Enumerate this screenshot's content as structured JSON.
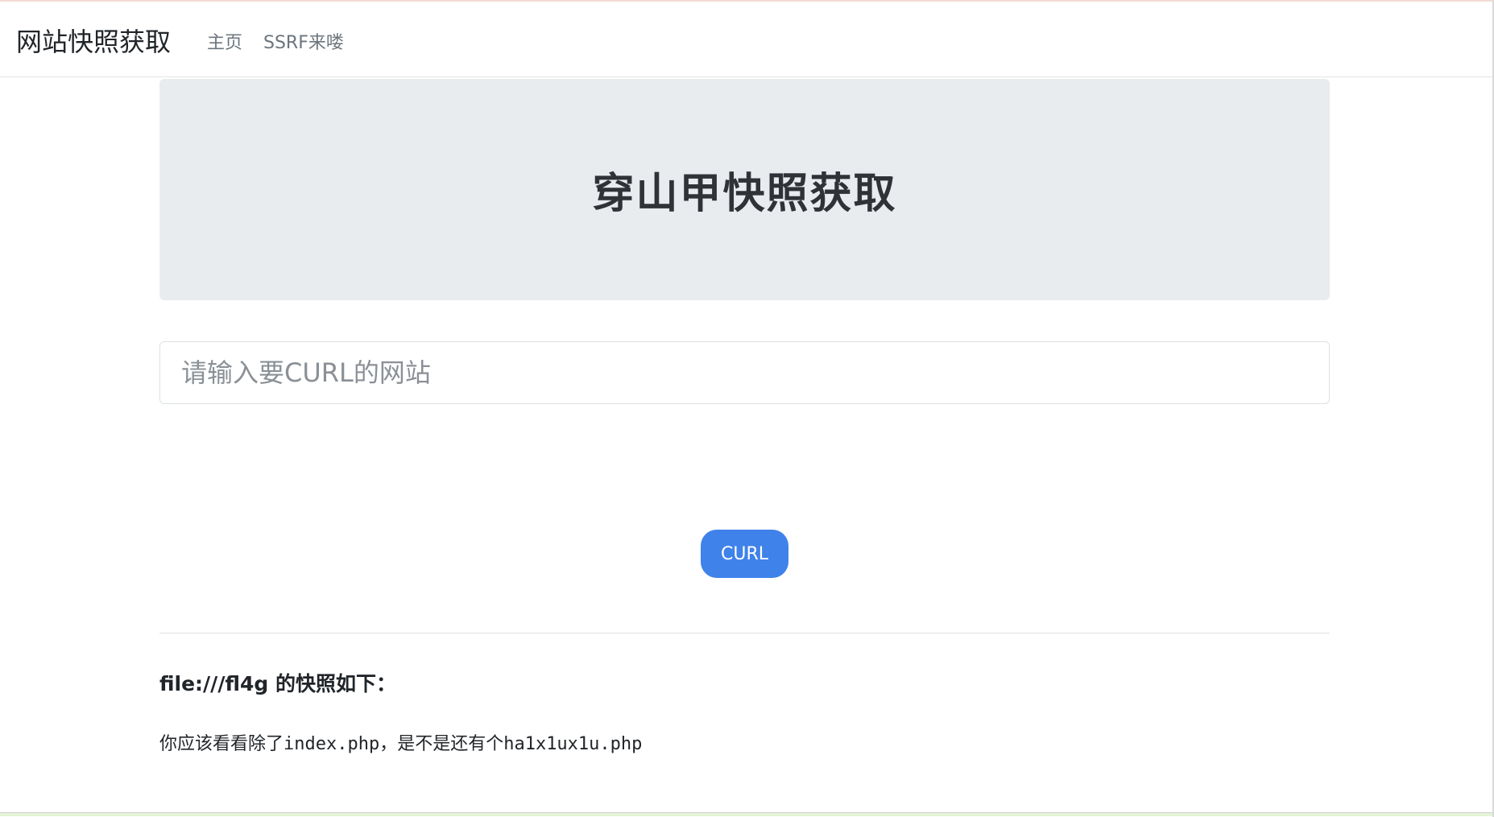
{
  "navbar": {
    "brand": "网站快照获取",
    "links": [
      "主页",
      "SSRF来喽"
    ]
  },
  "jumbotron": {
    "title": "穿山甲快照获取"
  },
  "form": {
    "url_placeholder": "请输入要CURL的网站",
    "url_value": "",
    "submit_label": "CURL"
  },
  "result": {
    "title": "file:///fl4g 的快照如下：",
    "body": "你应该看看除了index.php，是不是还有个ha1x1ux1u.php"
  },
  "colors": {
    "button": "#3f82ea",
    "jumbotron_bg": "#e8ecef"
  }
}
